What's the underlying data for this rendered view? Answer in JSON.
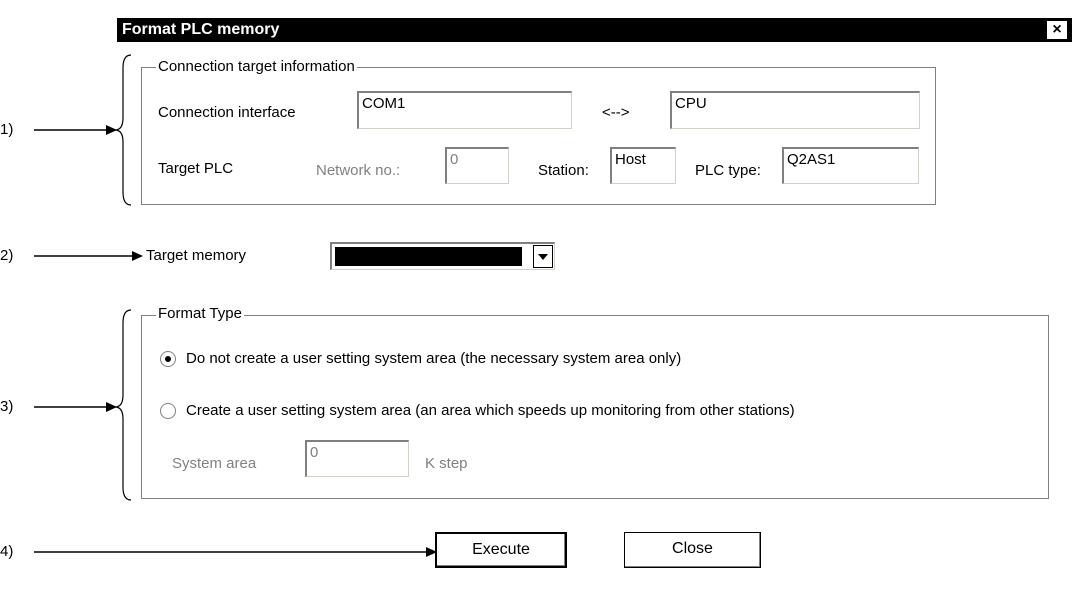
{
  "window": {
    "title": "Format PLC memory",
    "close_glyph": "×"
  },
  "connection": {
    "legend": "Connection target information",
    "interface_label": "Connection interface",
    "interface_value": "COM1",
    "arrow": "<-->",
    "target_value": "CPU",
    "target_plc_label": "Target PLC",
    "network_label": "Network no.:",
    "network_value": "0",
    "station_label": "Station:",
    "station_value": "Host",
    "plc_type_label": "PLC type:",
    "plc_type_value": "Q2AS1"
  },
  "target_memory": {
    "label": "Target memory",
    "value": ""
  },
  "format_type": {
    "legend": "Format Type",
    "options": [
      {
        "label": "Do not create a user setting system area (the necessary system area only)",
        "checked": true
      },
      {
        "label": "Create a user setting system area (an area which speeds up monitoring from other stations)",
        "checked": false
      }
    ],
    "system_area_label": "System area",
    "system_area_value": "0",
    "unit": "K step"
  },
  "buttons": {
    "execute": "Execute",
    "close": "Close"
  },
  "callouts": [
    "1)",
    "2)",
    "3)",
    "4)"
  ],
  "icons": {
    "close": "close-icon",
    "dropdown": "chevron-down-icon"
  }
}
